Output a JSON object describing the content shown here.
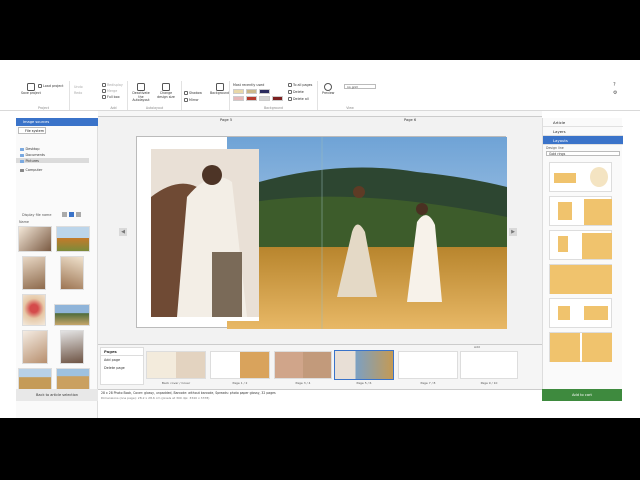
{
  "ribbon": {
    "project": {
      "save_label": "Save project",
      "load_label": "Load project",
      "group": "Project"
    },
    "edit": {
      "undo": "Undo",
      "redo": "Redo",
      "redisplay": "Redisplay",
      "merge": "Merge",
      "full_box": "Full box",
      "group": "Add"
    },
    "autolayout": {
      "deactivate": "Deactivate the Autolayout",
      "change": "Change design size",
      "group": "Autolayout"
    },
    "effects": {
      "shadow": "Shadow",
      "mirror": "Mirror",
      "background": "Background",
      "group": "Background"
    },
    "colors": {
      "most_recent": "Most recently used",
      "all_pages": "To all pages",
      "delete": "Delete",
      "delete_all": "Delete all",
      "group": "Background"
    },
    "view": {
      "preview": "Preview",
      "zoom": "no grid",
      "group": "View"
    }
  },
  "left": {
    "header": "Image sources",
    "tab": "File system",
    "tree": [
      "Desktop",
      "Documents",
      "Pictures",
      "Computer"
    ],
    "display": "Display file name",
    "name_col": "Name"
  },
  "canvas": {
    "page_left": "Page 5",
    "page_right": "Page 6"
  },
  "pages": {
    "title": "Pages",
    "add": "Add page",
    "delete": "Delete page",
    "thumbs": [
      "Back cover / Cover",
      "Page 1 / 2",
      "Page 3 / 4",
      "Page 5 / 6",
      "Page 7 / 8",
      "Page 9 / 10"
    ],
    "add_label": "Add"
  },
  "right": {
    "article": "Article",
    "layers": "Layers",
    "layouts": "Layouts",
    "design_line": "Design line",
    "design_value": "Gold rings"
  },
  "status": {
    "line1": "28 x 28 Photo Book, Cover: glossy, unpadded, Barcode: without barcode, Spreads: photo paper glossy, 32 pages",
    "line2": "Dimensions (one page): 28.2 x 28.6 cm (pixels at 300 dpi: 3340 x 3378)"
  },
  "buttons": {
    "back": "Back to article selection",
    "cart": "Add to cart"
  },
  "colors": {
    "accent": "#3a73c9",
    "cart": "#3e8a3e",
    "layout": "#f0c36d"
  }
}
